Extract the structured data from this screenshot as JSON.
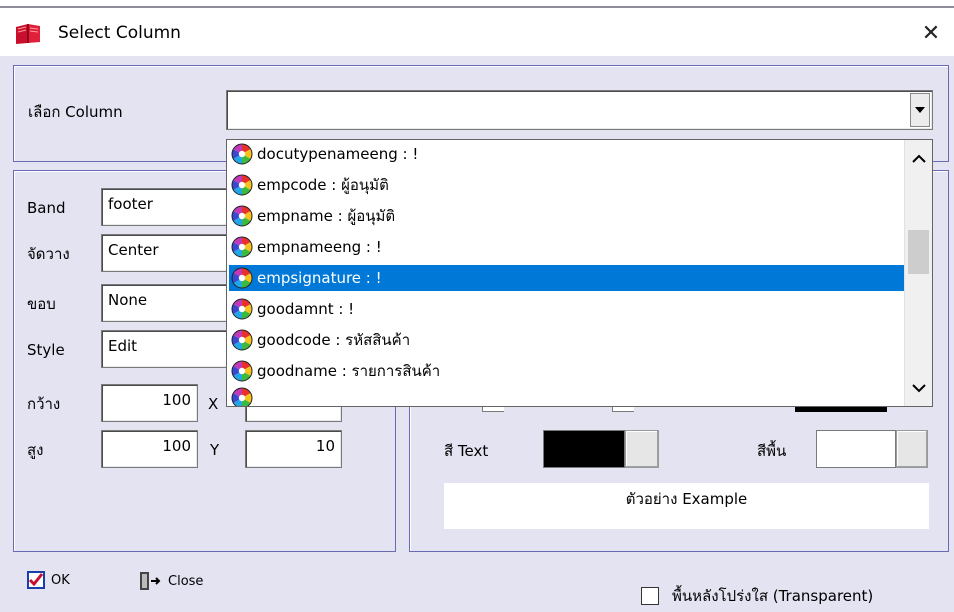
{
  "window": {
    "title": "Select Column",
    "close_glyph": "✕"
  },
  "column_select": {
    "label": "เลือก Column",
    "value": ""
  },
  "dropdown": {
    "items": [
      {
        "text": "docutypenameeng : !",
        "selected": false
      },
      {
        "text": "empcode : ผู้อนุมัติ",
        "selected": false
      },
      {
        "text": "empname : ผู้อนุมัติ",
        "selected": false
      },
      {
        "text": "empnameeng : !",
        "selected": false
      },
      {
        "text": "empsignature : !",
        "selected": true
      },
      {
        "text": "goodamnt : !",
        "selected": false
      },
      {
        "text": "goodcode : รหัสสินค้า",
        "selected": false
      },
      {
        "text": "goodname : รายการสินค้า",
        "selected": false
      }
    ]
  },
  "props": {
    "band": {
      "label": "Band",
      "value": "footer"
    },
    "align": {
      "label": "จัดวาง",
      "value": "Center"
    },
    "border": {
      "label": "ขอบ",
      "value": "None"
    },
    "style": {
      "label": "Style",
      "value": "Edit"
    },
    "width": {
      "label": "กว้าง",
      "value": "100"
    },
    "x": {
      "label": "X",
      "value": ""
    },
    "height": {
      "label": "สูง",
      "value": "100"
    },
    "y": {
      "label": "Y",
      "value": "10"
    }
  },
  "colors": {
    "text_label": "สี Text",
    "text_color": "#000000",
    "bg_label": "สีพื้น",
    "bg_color": "#ffffff",
    "accent": "#0078d7",
    "frame": "#6a6ab2"
  },
  "preview": {
    "text": "ตัวอย่าง Example"
  },
  "buttons": {
    "ok_label": "OK",
    "close_label": "Close"
  },
  "transparent": {
    "label": "พื้นหลังโปร่งใส (Transparent)",
    "checked": false
  },
  "icons": {
    "app": "book-icon",
    "close": "close-icon",
    "item": "color-wheel-icon",
    "ok": "check-icon",
    "exit": "door-exit-icon",
    "arrow_down": "chevron-down-icon",
    "arrow_up": "chevron-up-icon"
  }
}
